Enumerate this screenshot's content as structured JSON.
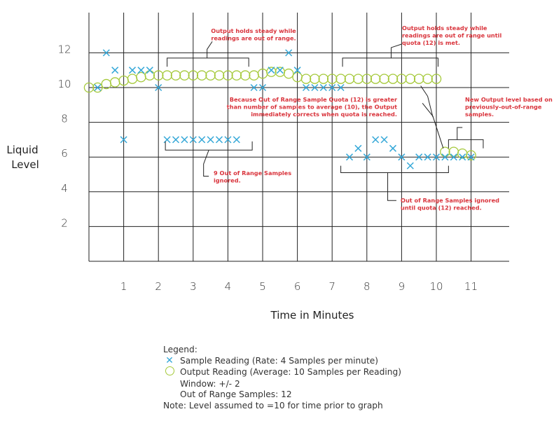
{
  "chart_data": {
    "type": "scatter",
    "title": "",
    "xlabel": "Time in Minutes",
    "ylabel": "Liquid Level",
    "xlim": [
      0,
      12
    ],
    "ylim": [
      0,
      14
    ],
    "grid": true,
    "x_ticks": [
      "1",
      "2",
      "3",
      "4",
      "5",
      "6",
      "7",
      "8",
      "9",
      "10",
      "11"
    ],
    "y_ticks": [
      "2",
      "4",
      "6",
      "8",
      "10",
      "12"
    ],
    "colors": {
      "sample": "#35a8d8",
      "output": "#a5c93a",
      "annotation": "#d9343c",
      "grid": "#222222"
    },
    "series": [
      {
        "name": "Sample Reading",
        "marker": "x",
        "points": [
          [
            0.25,
            10
          ],
          [
            0.5,
            12
          ],
          [
            0.75,
            11
          ],
          [
            1.0,
            7
          ],
          [
            1.25,
            11
          ],
          [
            1.5,
            11
          ],
          [
            1.75,
            11
          ],
          [
            2.0,
            10
          ],
          [
            2.25,
            7
          ],
          [
            2.5,
            7
          ],
          [
            2.75,
            7
          ],
          [
            3.0,
            7
          ],
          [
            3.25,
            7
          ],
          [
            3.5,
            7
          ],
          [
            3.75,
            7
          ],
          [
            4.0,
            7
          ],
          [
            4.25,
            7
          ],
          [
            4.75,
            10
          ],
          [
            5.0,
            10
          ],
          [
            5.25,
            11
          ],
          [
            5.5,
            11
          ],
          [
            5.75,
            12
          ],
          [
            6.0,
            11
          ],
          [
            6.25,
            10
          ],
          [
            6.5,
            10
          ],
          [
            6.75,
            10
          ],
          [
            7.0,
            10
          ],
          [
            7.25,
            10
          ],
          [
            7.5,
            6
          ],
          [
            7.75,
            6.5
          ],
          [
            8.0,
            6
          ],
          [
            8.25,
            7
          ],
          [
            8.5,
            7
          ],
          [
            8.75,
            6.5
          ],
          [
            9.0,
            6
          ],
          [
            9.25,
            5.5
          ],
          [
            9.5,
            6
          ],
          [
            9.75,
            6
          ],
          [
            10.0,
            6
          ],
          [
            10.25,
            6
          ],
          [
            10.5,
            6
          ],
          [
            10.75,
            6
          ],
          [
            11.0,
            6
          ]
        ]
      },
      {
        "name": "Output Reading",
        "marker": "o",
        "points": [
          [
            0.0,
            10
          ],
          [
            0.25,
            10
          ],
          [
            0.5,
            10.2
          ],
          [
            0.75,
            10.3
          ],
          [
            1.0,
            10.4
          ],
          [
            1.25,
            10.5
          ],
          [
            1.5,
            10.6
          ],
          [
            1.75,
            10.7
          ],
          [
            2.0,
            10.7
          ],
          [
            2.25,
            10.7
          ],
          [
            2.5,
            10.7
          ],
          [
            2.75,
            10.7
          ],
          [
            3.0,
            10.7
          ],
          [
            3.25,
            10.7
          ],
          [
            3.5,
            10.7
          ],
          [
            3.75,
            10.7
          ],
          [
            4.0,
            10.7
          ],
          [
            4.25,
            10.7
          ],
          [
            4.5,
            10.7
          ],
          [
            4.75,
            10.7
          ],
          [
            5.0,
            10.8
          ],
          [
            5.25,
            10.9
          ],
          [
            5.5,
            10.9
          ],
          [
            5.75,
            10.8
          ],
          [
            6.0,
            10.6
          ],
          [
            6.25,
            10.5
          ],
          [
            6.5,
            10.5
          ],
          [
            6.75,
            10.5
          ],
          [
            7.0,
            10.5
          ],
          [
            7.25,
            10.5
          ],
          [
            7.5,
            10.5
          ],
          [
            7.75,
            10.5
          ],
          [
            8.0,
            10.5
          ],
          [
            8.25,
            10.5
          ],
          [
            8.5,
            10.5
          ],
          [
            8.75,
            10.5
          ],
          [
            9.0,
            10.5
          ],
          [
            9.25,
            10.5
          ],
          [
            9.5,
            10.5
          ],
          [
            9.75,
            10.5
          ],
          [
            10.0,
            10.5
          ],
          [
            10.25,
            6.3
          ],
          [
            10.5,
            6.3
          ],
          [
            10.75,
            6.2
          ],
          [
            11.0,
            6.1
          ]
        ]
      }
    ],
    "annotations": [
      {
        "lines": [
          "Output holds steady while",
          "readings are out of range."
        ]
      },
      {
        "lines": [
          "Output holds steady while",
          "readings are out of range until",
          "quota (12) is met."
        ]
      },
      {
        "lines": [
          "Because Out of Range Sample Quota (12) is greater",
          "than number of samples to average (10), the Output",
          "immediately corrects when quota is reached."
        ]
      },
      {
        "lines": [
          "New Output level based on",
          "previously-out-of-range",
          "samples."
        ]
      },
      {
        "lines": [
          "9 Out of Range Samples",
          "ignored."
        ]
      },
      {
        "lines": [
          "Out of Range Samples ignored",
          "until quota (12) reached."
        ]
      }
    ]
  },
  "legend": {
    "title": "Legend:",
    "sample_label": "Sample Reading (Rate: 4 Samples per minute)",
    "output_label": "Output Reading (Average: 10 Samples per Reading)",
    "window": "Window: +/- 2",
    "out_of_range": "Out of Range Samples: 12",
    "note": "Note: Level assumed to =10 for time prior to graph"
  }
}
